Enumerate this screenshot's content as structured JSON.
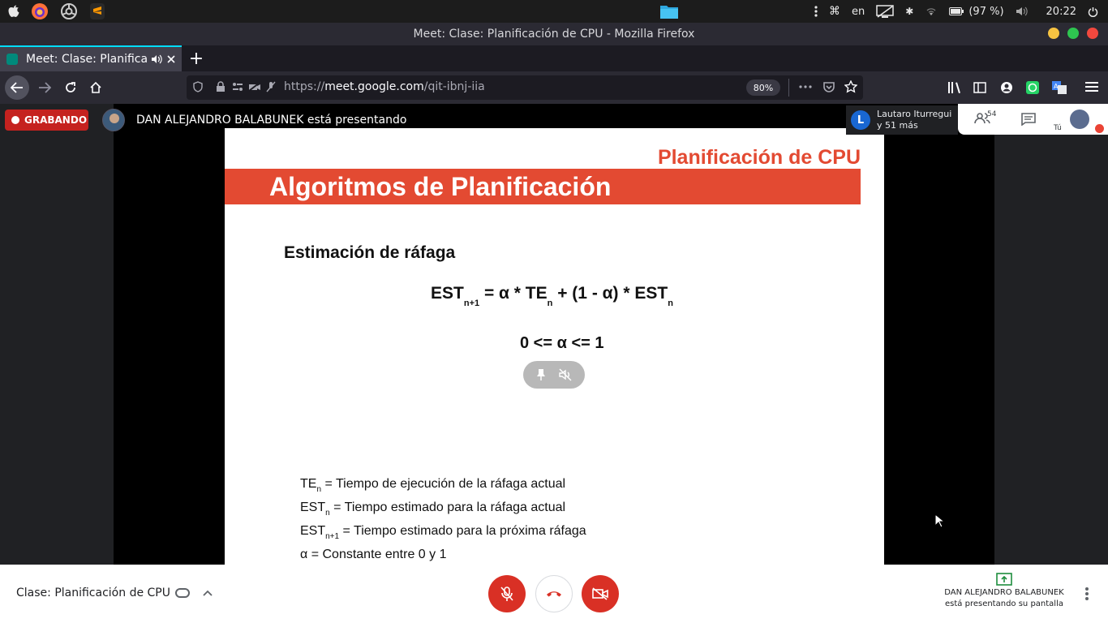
{
  "os_bar": {
    "language": "en",
    "battery": "(97 %)",
    "clock": "20:22"
  },
  "window": {
    "title": "Meet: Clase: Planificación de CPU - Mozilla Firefox"
  },
  "tab": {
    "label": "Meet: Clase: Planificac",
    "new_tab_label": "+"
  },
  "urlbar": {
    "scheme": "https://",
    "host": "meet.google.com",
    "path": "/qit-ibnj-iia",
    "zoom": "80%"
  },
  "meet": {
    "recording_label": "GRABANDO",
    "presenter_text": "DAN ALEJANDRO BALABUNEK está presentando",
    "participant_chip": {
      "initial": "L",
      "name": "Lautaro Iturregui",
      "more": "y 51 más"
    },
    "people_count": "54",
    "self_label": "Tú"
  },
  "slide": {
    "subtitle": "Planificación de CPU",
    "title": "Algoritmos de Planificación",
    "heading": "Estimación de ráfaga",
    "formula": {
      "lhs": "EST",
      "lhs_sub": "n+1",
      "eq": " = α * TE",
      "te_sub": "n",
      "rest": " + (1 - α) * EST",
      "est_sub": "n"
    },
    "constraint": "0 <= α <= 1",
    "legend": [
      {
        "sym": "TE",
        "sub": "n",
        "text": " = Tiempo de ejecución de la ráfaga actual"
      },
      {
        "sym": "EST",
        "sub": "n",
        "text": " = Tiempo estimado para la ráfaga actual"
      },
      {
        "sym": "EST",
        "sub": "n+1",
        "text": " = Tiempo estimado para la próxima ráfaga"
      },
      {
        "sym": "α",
        "sub": "",
        "text": " = Constante entre 0 y 1"
      }
    ]
  },
  "bottom": {
    "meeting_name": "Clase: Planificación de CPU",
    "presenting_name": "DAN ALEJANDRO BALABUNEK",
    "presenting_text": "está presentando su pantalla"
  },
  "colors": {
    "slide_red": "#e34a32",
    "recording_red": "#c5221f",
    "control_red": "#d93025",
    "focus_blue": "#00ddff"
  }
}
